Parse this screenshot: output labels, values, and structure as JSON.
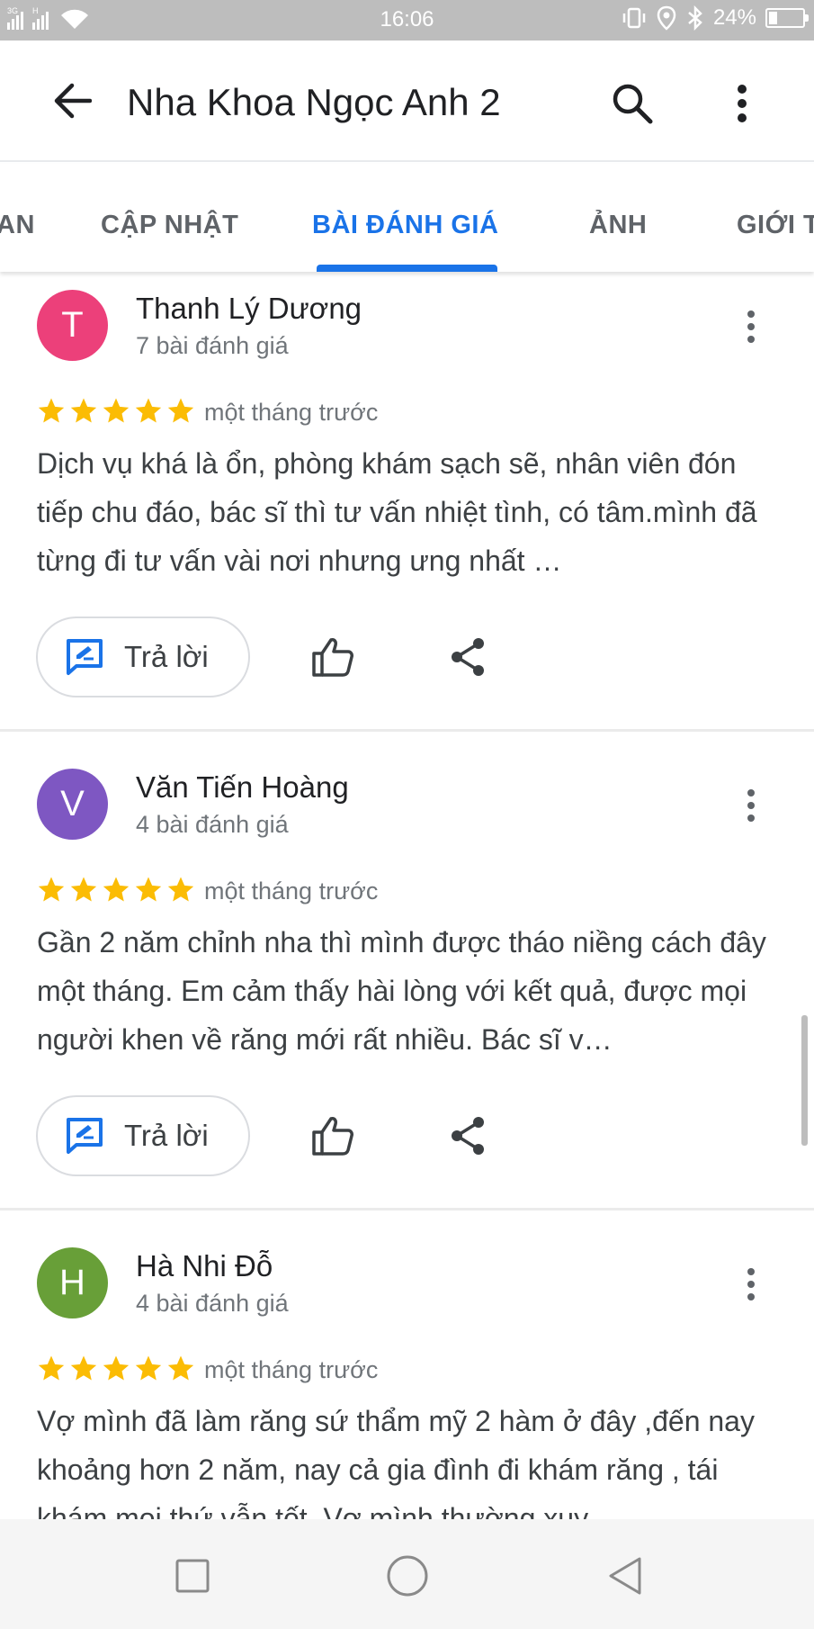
{
  "status_bar": {
    "network_left": "3G",
    "network_right": "H",
    "time": "16:06",
    "battery_percent": "24%",
    "battery_level": 0.24
  },
  "header": {
    "title": "Nha Khoa Ngọc Anh 2",
    "back_icon": "arrow-back-icon",
    "search_icon": "search-icon",
    "more_icon": "more-vert-icon"
  },
  "tabs": [
    {
      "label": "AN",
      "active": false
    },
    {
      "label": "CẬP NHẬT",
      "active": false
    },
    {
      "label": "BÀI ĐÁNH GIÁ",
      "active": true
    },
    {
      "label": "ẢNH",
      "active": false
    },
    {
      "label": "GIỚI T",
      "active": false
    }
  ],
  "accent_color": "#1a73e8",
  "star_color": "#fbbc04",
  "reviews": [
    {
      "initial": "T",
      "avatar_color": "#ec407a",
      "name": "Thanh Lý Dương",
      "review_count": "7 bài đánh giá",
      "rating": 5,
      "time": "một tháng trước",
      "text": "Dịch vụ khá là ổn, phòng khám sạch sẽ, nhân viên đón tiếp chu đáo, bác sĩ thì tư vấn nhiệt tình, có tâm.mình đã từng đi tư vấn vài nơi nhưng ưng nhất …",
      "reply_label": "Trả lời"
    },
    {
      "initial": "V",
      "avatar_color": "#7e57c2",
      "name": "Văn Tiến Hoàng",
      "review_count": "4 bài đánh giá",
      "rating": 5,
      "time": "một tháng trước",
      "text": "Gần 2 năm chỉnh nha thì mình được tháo niềng cách đây một tháng. Em cảm thấy hài lòng với kết quả, được mọi người khen về răng mới rất nhiều. Bác sĩ v…",
      "reply_label": "Trả lời"
    },
    {
      "initial": "H",
      "avatar_color": "#689f38",
      "name": "Hà Nhi Đỗ",
      "review_count": "4 bài đánh giá",
      "rating": 5,
      "time": "một tháng trước",
      "text": "Vợ mình đã làm răng sứ thẩm mỹ 2 hàm ở đây ,đến nay khoảng hơn 2 năm, nay cả gia đình đi khám răng , tái khám mọi thứ vẫn tốt. Vợ mình thường xuy",
      "reply_label": "Trả lời"
    }
  ],
  "nav_bar": {
    "recents_icon": "square-icon",
    "home_icon": "circle-icon",
    "back_icon": "triangle-back-icon"
  }
}
